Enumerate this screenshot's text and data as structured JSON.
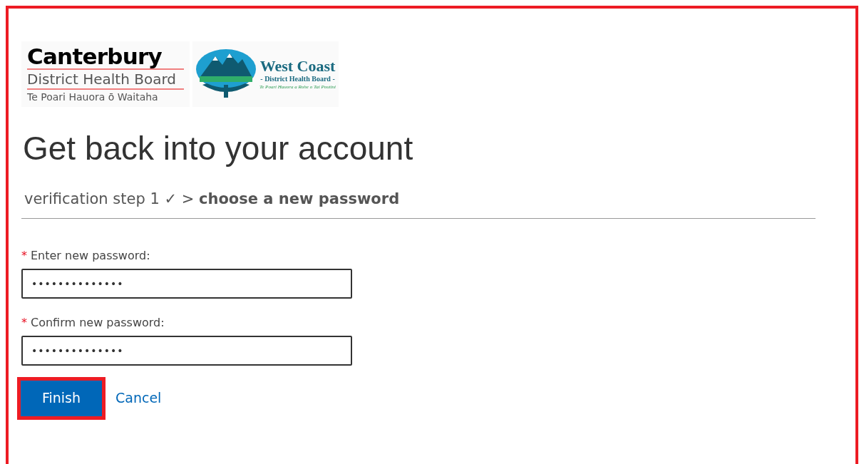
{
  "logos": [
    {
      "kind": "canterbury",
      "title": "Canterbury",
      "subtitle": "District Health Board",
      "tagline": "Te Poari Hauora ō Waitaha"
    },
    {
      "kind": "westcoast",
      "title": "West Coast",
      "subtitle": "- District Health Board -",
      "tagline": "Te Poari Hauora a Rohe o Tai Poutini"
    }
  ],
  "heading": "Get back into your account",
  "breadcrumb": "verification step 1 ✓ > **choose a new password**",
  "fields": [
    {
      "required_mark": "*",
      "label": "Enter new password:",
      "value": "••••••••••••••"
    },
    {
      "required_mark": "*",
      "label": "Confirm new password:",
      "value": "••••••••••••••"
    }
  ],
  "finish_button": {
    "label": "Finish",
    "highlighted": true
  },
  "cancel_link": "Cancel"
}
